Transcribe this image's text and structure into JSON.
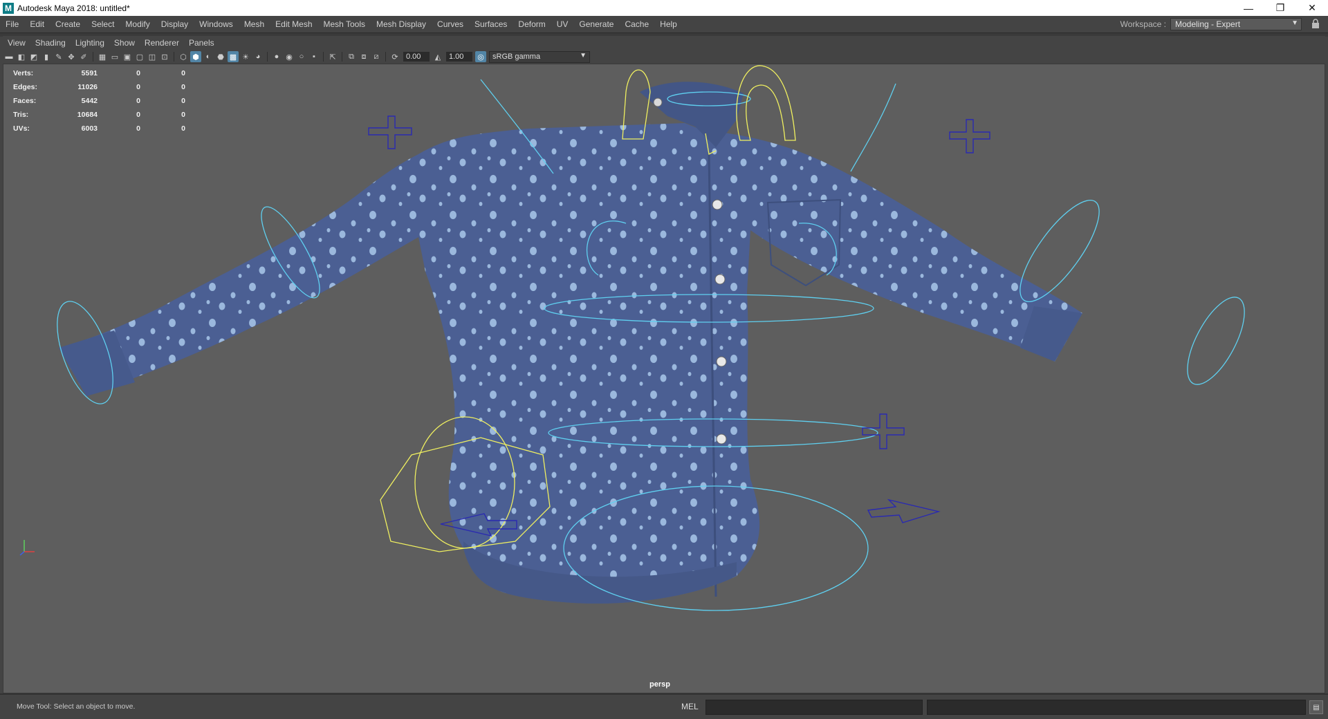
{
  "window": {
    "title": "Autodesk Maya 2018: untitled*",
    "logo_letter": "M",
    "controls": {
      "minimize": "—",
      "restore": "❐",
      "close": "✕"
    }
  },
  "menubar": {
    "items": [
      "File",
      "Edit",
      "Create",
      "Select",
      "Modify",
      "Display",
      "Windows",
      "Mesh",
      "Edit Mesh",
      "Mesh Tools",
      "Mesh Display",
      "Curves",
      "Surfaces",
      "Deform",
      "UV",
      "Generate",
      "Cache",
      "Help"
    ],
    "workspace_label": "Workspace :",
    "workspace_value": "Modeling - Expert"
  },
  "panel_menu": {
    "items": [
      "View",
      "Shading",
      "Lighting",
      "Show",
      "Renderer",
      "Panels"
    ]
  },
  "toolbar": {
    "exposure": "0.00",
    "gamma": "1.00",
    "color_space": "sRGB gamma"
  },
  "hud": {
    "rows": [
      {
        "label": "Verts:",
        "v1": "5591",
        "v2": "0",
        "v3": "0"
      },
      {
        "label": "Edges:",
        "v1": "11026",
        "v2": "0",
        "v3": "0"
      },
      {
        "label": "Faces:",
        "v1": "5442",
        "v2": "0",
        "v3": "0"
      },
      {
        "label": "Tris:",
        "v1": "10684",
        "v2": "0",
        "v3": "0"
      },
      {
        "label": "UVs:",
        "v1": "6003",
        "v2": "0",
        "v3": "0"
      }
    ]
  },
  "viewport": {
    "camera": "persp",
    "colors": {
      "background": "#5e5e5e",
      "shirt": "#4b5f93",
      "dots": "#a9c8ea",
      "controls_cyan": "#5fd0f0",
      "controls_yellow": "#f0f060",
      "controls_blue": "#2a2ab0"
    }
  },
  "statusbar": {
    "help_text": "Move Tool: Select an object to move.",
    "mel_label": "MEL"
  }
}
